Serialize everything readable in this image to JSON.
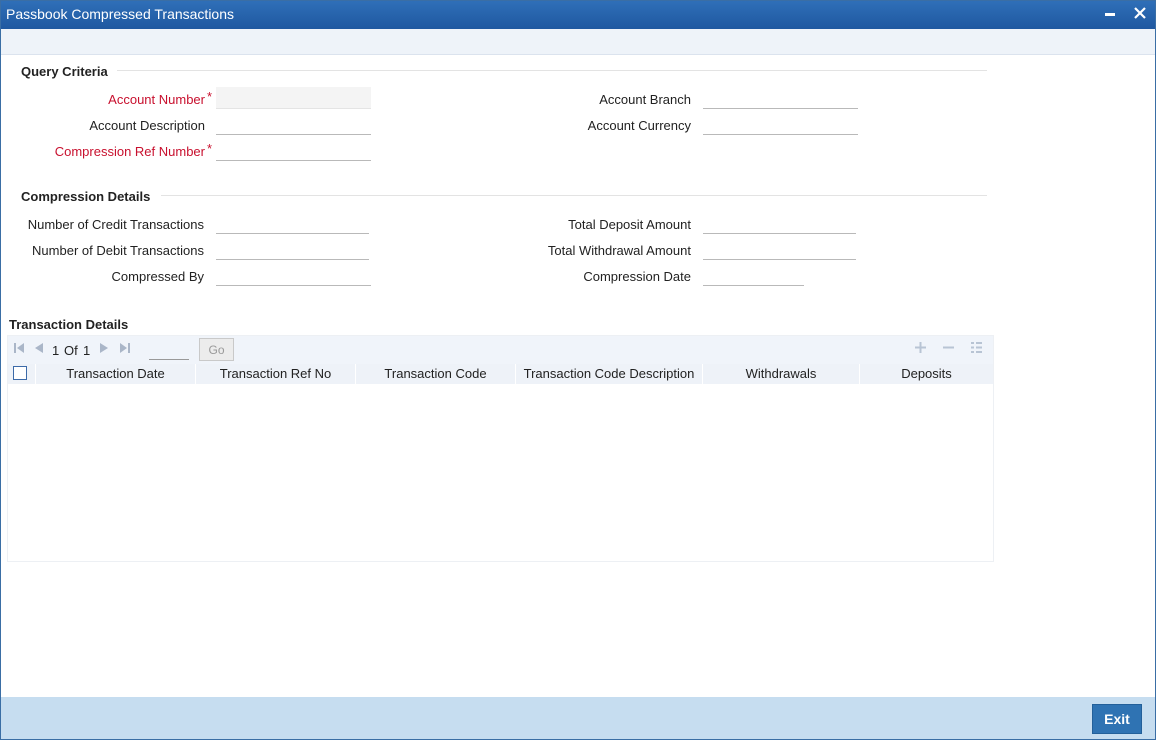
{
  "window": {
    "title": "Passbook Compressed Transactions"
  },
  "query_criteria": {
    "title": "Query Criteria",
    "account_number_label": "Account Number",
    "account_description_label": "Account Description",
    "compression_ref_label": "Compression Ref Number",
    "account_branch_label": "Account Branch",
    "account_currency_label": "Account Currency",
    "required_mark": "*",
    "account_number_value": "",
    "account_description_value": "",
    "compression_ref_value": "",
    "account_branch_value": "",
    "account_currency_value": ""
  },
  "compression_details": {
    "title": "Compression Details",
    "credit_count_label": "Number of Credit Transactions",
    "debit_count_label": "Number of Debit Transactions",
    "compressed_by_label": "Compressed By",
    "total_deposit_label": "Total Deposit Amount",
    "total_withdrawal_label": "Total Withdrawal Amount",
    "compression_date_label": "Compression Date",
    "credit_count_value": "",
    "debit_count_value": "",
    "compressed_by_value": "",
    "total_deposit_value": "",
    "total_withdrawal_value": "",
    "compression_date_value": ""
  },
  "transaction_details": {
    "title": "Transaction Details",
    "pager": {
      "current": "1",
      "of_label": "Of",
      "total": "1",
      "go_label": "Go",
      "page_input": ""
    },
    "columns": [
      "Transaction Date",
      "Transaction Ref No",
      "Transaction Code",
      "Transaction Code Description",
      "Withdrawals",
      "Deposits"
    ],
    "rows": []
  },
  "footer": {
    "exit_label": "Exit"
  },
  "icons": {
    "minimize": "minimize-icon",
    "close": "close-icon",
    "first": "first-page-icon",
    "prev": "prev-page-icon",
    "next": "next-page-icon",
    "last": "last-page-icon",
    "add": "add-row-icon",
    "delete": "delete-row-icon",
    "view": "single-view-icon"
  },
  "colors": {
    "title_bar": "#1f58a0",
    "required_label": "#c8102e",
    "footer": "#c6ddf0",
    "exit_button": "#2f73b3"
  }
}
